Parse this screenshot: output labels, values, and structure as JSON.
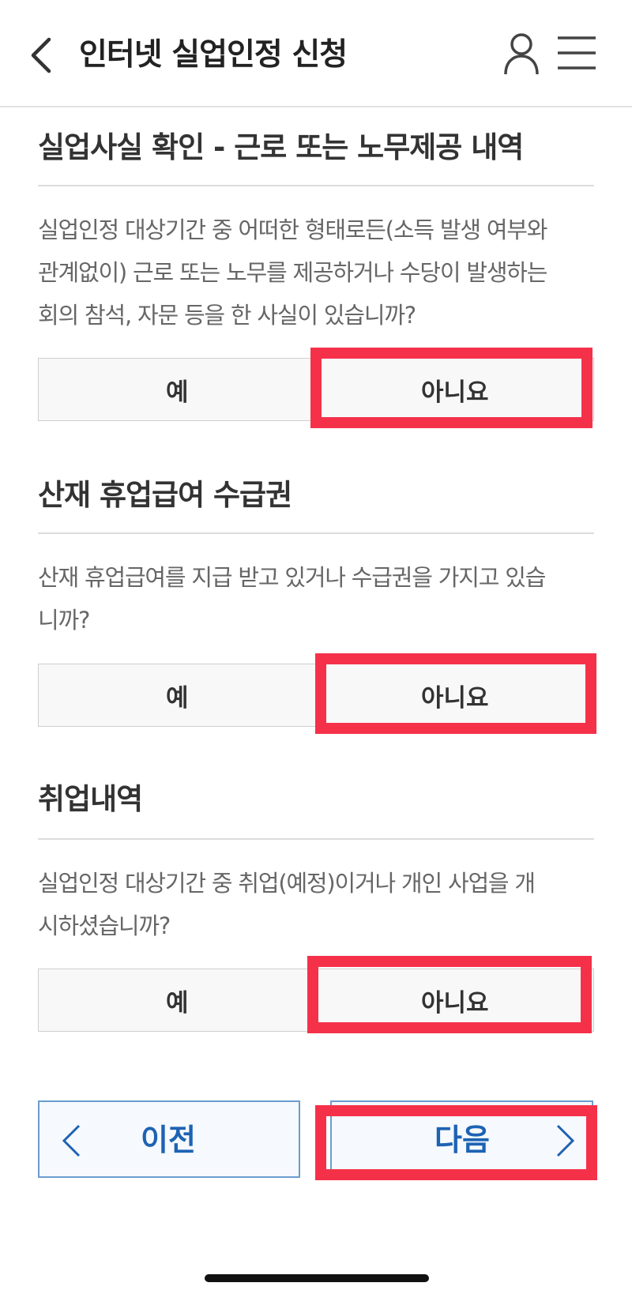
{
  "header": {
    "title": "인터넷 실업인정 신청",
    "back_icon": "back-chevron-icon",
    "user_icon": "user-icon",
    "menu_icon": "hamburger-menu-icon"
  },
  "sections": [
    {
      "title": "실업사실 확인 - 근로 또는 노무제공 내역",
      "question_lines": [
        "실업인정 대상기간 중 어떠한 형태로든(소득 발생 여부와",
        "관계없이) 근로 또는 노무를 제공하거나 수당이 발생하는",
        "회의 참석, 자문 등을 한 사실이 있습니까?"
      ],
      "yes": "예",
      "no": "아니요"
    },
    {
      "title": "산재 휴업급여 수급권",
      "question_lines": [
        "산재 휴업급여를 지급 받고 있거나 수급권을 가지고 있습",
        "니까?"
      ],
      "yes": "예",
      "no": "아니요"
    },
    {
      "title": "취업내역",
      "question_lines": [
        "실업인정 대상기간 중 취업(예정)이거나 개인 사업을 개",
        "시하셨습니까?"
      ],
      "yes": "예",
      "no": "아니요"
    }
  ],
  "nav": {
    "prev": "이전",
    "next": "다음"
  },
  "colors": {
    "highlight": "#f5314a",
    "nav_text": "#1d63b3",
    "nav_border": "#6a9dd0"
  }
}
